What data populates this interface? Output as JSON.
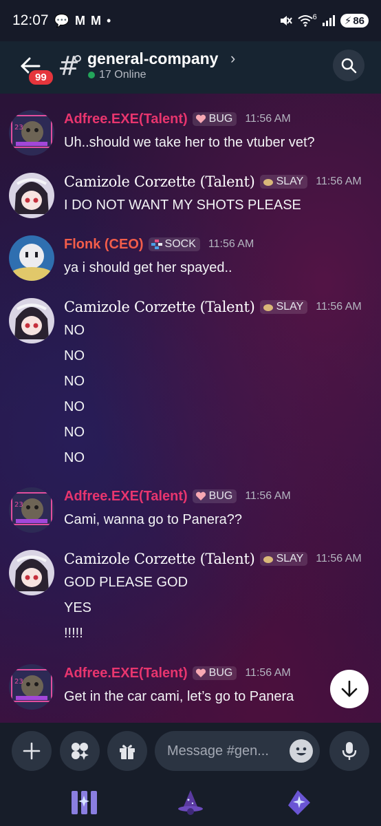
{
  "status_bar": {
    "time": "12:07",
    "notif_glyphs": [
      "💬",
      "M",
      "M",
      "•"
    ],
    "signal_label": "6",
    "battery": "86"
  },
  "header": {
    "unread_count": "99",
    "channel_name": "general-company",
    "online": "17 Online"
  },
  "colors": {
    "adfree": "#e8356e",
    "camizole": "#ffffff",
    "flonk": "#f35d4a",
    "accent_online": "#23a55a"
  },
  "messages": [
    {
      "user": "Adfree.EXE(Talent)",
      "tag": "BUG",
      "time": "11:56 AM",
      "lines": [
        "Uh..should we take her to the vtuber vet?"
      ]
    },
    {
      "user": "Camizole Corzette (Talent)",
      "tag": "SLAY",
      "time": "11:56 AM",
      "lines": [
        "I DO NOT WANT MY SHOTS PLEASE"
      ]
    },
    {
      "user": "Flonk (CEO)",
      "tag": "SOCK",
      "time": "11:56 AM",
      "lines": [
        "ya i should get her spayed.."
      ]
    },
    {
      "user": "Camizole Corzette (Talent)",
      "tag": "SLAY",
      "time": "11:56 AM",
      "lines": [
        "NO",
        "NO",
        "NO",
        "NO",
        "NO",
        "NO"
      ]
    },
    {
      "user": "Adfree.EXE(Talent)",
      "tag": "BUG",
      "time": "11:56 AM",
      "lines": [
        "Cami, wanna go to Panera??"
      ]
    },
    {
      "user": "Camizole Corzette (Talent)",
      "tag": "SLAY",
      "time": "11:56 AM",
      "lines": [
        "GOD PLEASE GOD",
        "YES",
        "!!!!!"
      ]
    },
    {
      "user": "Adfree.EXE(Talent)",
      "tag": "BUG",
      "time": "11:56 AM",
      "lines": [
        "Get in the car cami, let’s go to Panera"
      ]
    }
  ],
  "composer": {
    "placeholder": "Message #gen..."
  },
  "icons": {
    "back": "arrow-left-icon",
    "channel": "hash-thread-icon",
    "search": "search-icon",
    "scroll": "arrow-down-icon",
    "add": "plus-icon",
    "apps": "apps-icon",
    "gift": "gift-icon",
    "emoji": "emoji-icon",
    "mic": "microphone-icon"
  }
}
